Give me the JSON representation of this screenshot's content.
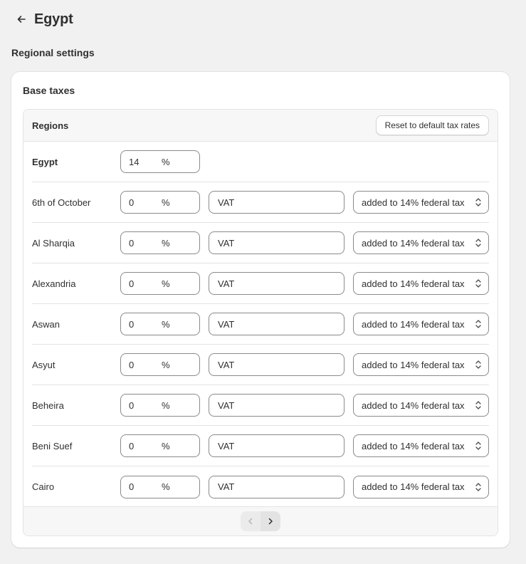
{
  "page": {
    "title": "Egypt",
    "back_icon": "arrow-left-icon"
  },
  "section": {
    "title": "Regional settings"
  },
  "card": {
    "title": "Base taxes",
    "table_header": "Regions",
    "reset_label": "Reset to default tax rates",
    "country": {
      "name": "Egypt",
      "rate": "14",
      "unit": "%"
    },
    "regions": [
      {
        "name": "6th of October",
        "rate": "0",
        "unit": "%",
        "tax_name": "VAT",
        "method": "added to 14% federal tax"
      },
      {
        "name": "Al Sharqia",
        "rate": "0",
        "unit": "%",
        "tax_name": "VAT",
        "method": "added to 14% federal tax"
      },
      {
        "name": "Alexandria",
        "rate": "0",
        "unit": "%",
        "tax_name": "VAT",
        "method": "added to 14% federal tax"
      },
      {
        "name": "Aswan",
        "rate": "0",
        "unit": "%",
        "tax_name": "VAT",
        "method": "added to 14% federal tax"
      },
      {
        "name": "Asyut",
        "rate": "0",
        "unit": "%",
        "tax_name": "VAT",
        "method": "added to 14% federal tax"
      },
      {
        "name": "Beheira",
        "rate": "0",
        "unit": "%",
        "tax_name": "VAT",
        "method": "added to 14% federal tax"
      },
      {
        "name": "Beni Suef",
        "rate": "0",
        "unit": "%",
        "tax_name": "VAT",
        "method": "added to 14% federal tax"
      },
      {
        "name": "Cairo",
        "rate": "0",
        "unit": "%",
        "tax_name": "VAT",
        "method": "added to 14% federal tax"
      }
    ],
    "pagination": {
      "prev_icon": "chevron-left-icon",
      "next_icon": "chevron-right-icon",
      "prev_disabled": true
    }
  }
}
